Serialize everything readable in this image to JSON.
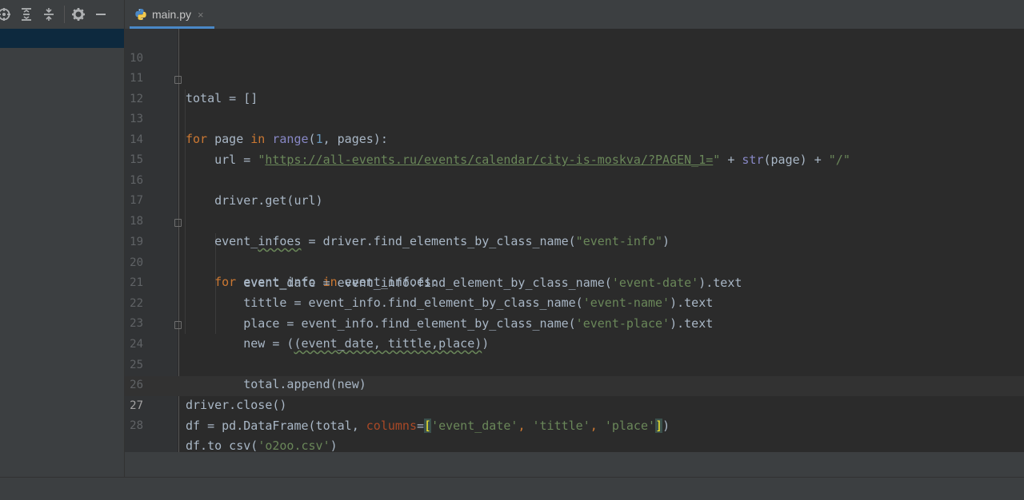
{
  "toolbar": {
    "icons": [
      "locate-icon",
      "expand-all-icon",
      "collapse-all-icon",
      "settings-icon",
      "hide-icon"
    ]
  },
  "tab": {
    "label": "main.py",
    "close": "×"
  },
  "editor": {
    "current_line": "27",
    "lines": [
      {
        "num": "10"
      },
      {
        "num": "11"
      },
      {
        "num": "12"
      },
      {
        "num": "13"
      },
      {
        "num": "14"
      },
      {
        "num": "15"
      },
      {
        "num": "16"
      },
      {
        "num": "17"
      },
      {
        "num": "18"
      },
      {
        "num": "19"
      },
      {
        "num": "20"
      },
      {
        "num": "21"
      },
      {
        "num": "22"
      },
      {
        "num": "23"
      },
      {
        "num": "24"
      },
      {
        "num": "25"
      },
      {
        "num": "26"
      },
      {
        "num": "27"
      },
      {
        "num": "28"
      }
    ],
    "tokens": {
      "l11_a": "total = []",
      "l12_for": "for",
      "l12_b": " page ",
      "l12_in": "in",
      "l12_sp": " ",
      "l12_range": "range",
      "l12_c": "(",
      "l12_one": "1",
      "l12_d": ", pages):",
      "l14_a": "    url = ",
      "l14_q1": "\"",
      "l14_url": "https://all-events.ru/events/calendar/city-is-moskva/?PAGEN_1=",
      "l14_q2": "\"",
      "l14_b": " + ",
      "l14_str": "str",
      "l14_c": "(page) + ",
      "l14_slash": "\"/\"",
      "l16_a": "    driver.get(url)",
      "l18_a": "    event_",
      "l18_w": "infoes",
      "l18_b": " = driver.find_elements_by_class_name(",
      "l18_s": "\"event-info\"",
      "l18_c": ")",
      "l19_sp": "    ",
      "l19_for": "for",
      "l19_b": " event_info ",
      "l19_in": "in",
      "l19_c": " event_infoes:",
      "l20_a": "        event_date = event_info.find_element_by_class_name(",
      "l20_s": "'event-date'",
      "l20_b": ").text",
      "l21_a": "        tittle = event_info.find_element_by_class_name(",
      "l21_s": "'event-name'",
      "l21_b": ").text",
      "l22_a": "        place = event_info.find_element_by_class_name(",
      "l22_s": "'event-place'",
      "l22_b": ").text",
      "l23_a": "        new = (",
      "l23_w": "(event_date, tittle,place)",
      "l23_b": ")",
      "l24_a": "        total.append(new)",
      "l26_a": "driver.close()",
      "l27_a": "df = pd.DataFrame(total, ",
      "l27_p": "columns",
      "l27_eq": "=",
      "l27_br1": "[",
      "l27_s1": "'event_date'",
      "l27_c1": ", ",
      "l27_s2": "'tittle'",
      "l27_c2": ", ",
      "l27_s3": "'place'",
      "l27_br2": "]",
      "l27_end": ")",
      "l28_a": "df.to_csv(",
      "l28_s": "'o2oo.csv'",
      "l28_b": ")"
    }
  }
}
